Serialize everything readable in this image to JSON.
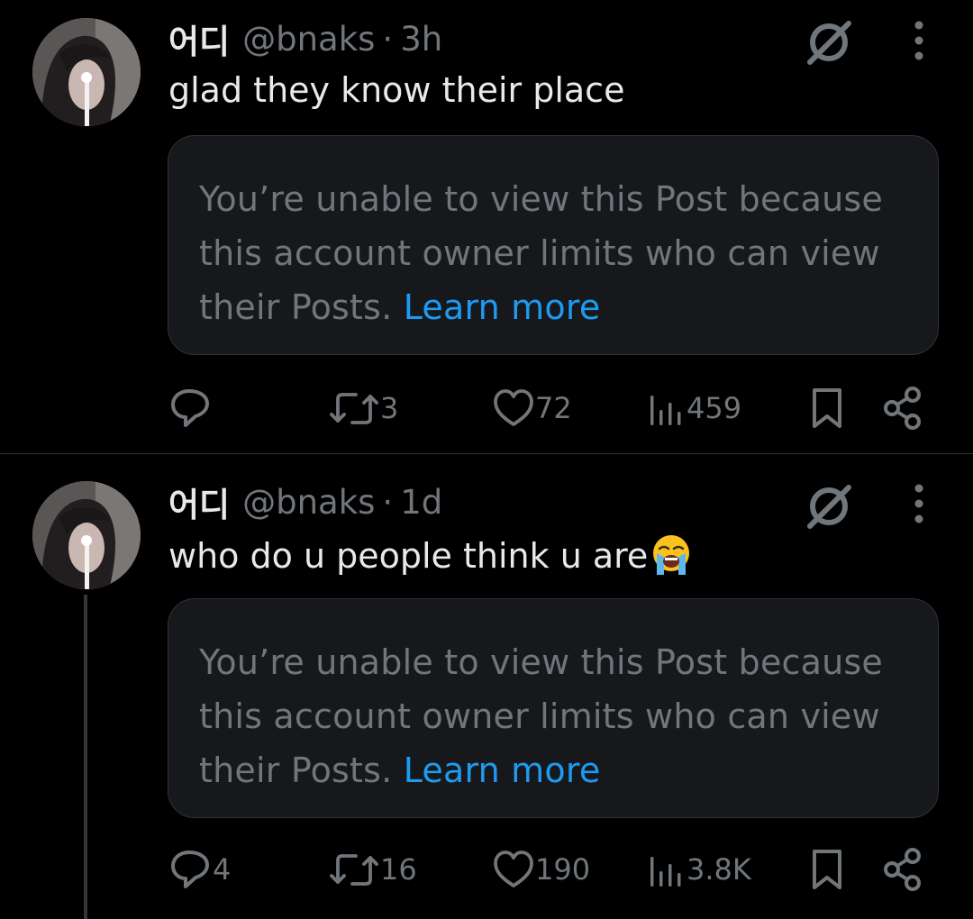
{
  "colors": {
    "background": "#000000",
    "primary_text": "#e7e9ea",
    "secondary_text": "#71767b",
    "link": "#1d9bf0",
    "card_bg": "#16181c",
    "border": "#2f3336"
  },
  "posts": [
    {
      "display_name": "어디",
      "handle": "@bnaks",
      "separator": "·",
      "time": "3h",
      "text": "glad they know their place",
      "emoji": "",
      "card": {
        "message": "You’re unable to view this Post because this account owner limits who can view their Posts.",
        "link": "Learn more"
      },
      "icons": {
        "avatar": "profile-photo",
        "restricted": "no-reply-icon",
        "more": "more-vertical-icon"
      },
      "counts": {
        "replies": "",
        "reposts": "3",
        "likes": "72",
        "views": "459"
      }
    },
    {
      "display_name": "어디",
      "handle": "@bnaks",
      "separator": "·",
      "time": "1d",
      "text": "who do u people think u are",
      "emoji": "loudly-crying-face",
      "card": {
        "message": "You’re unable to view this Post because this account owner limits who can view their Posts.",
        "link": "Learn more"
      },
      "icons": {
        "avatar": "profile-photo",
        "restricted": "no-reply-icon",
        "more": "more-vertical-icon"
      },
      "counts": {
        "replies": "4",
        "reposts": "16",
        "likes": "190",
        "views": "3.8K"
      }
    }
  ]
}
